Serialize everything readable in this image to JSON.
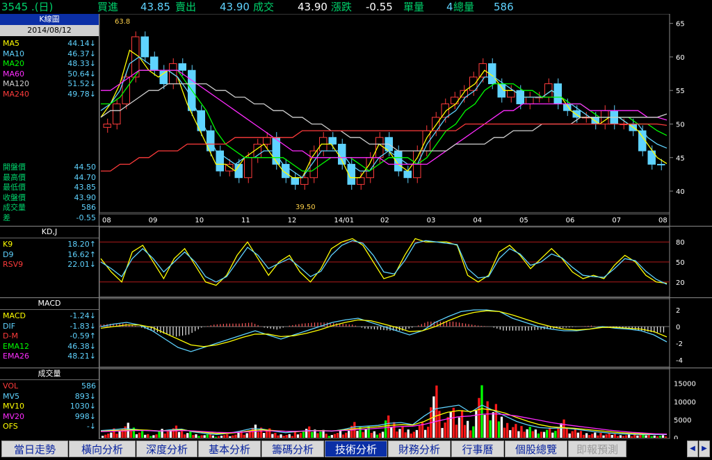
{
  "header": {
    "symbol": "3545 .(日)",
    "bid_label": "買進",
    "bid": "43.85",
    "ask_label": "賣出",
    "ask": "43.90",
    "trade_label": "成交",
    "trade": "43.90",
    "change_label": "漲跌",
    "change": "-0.55",
    "vol_label": "單量",
    "vol": "4",
    "total_label": "總量",
    "total": "586"
  },
  "kline_panel": {
    "title": "K線圖",
    "date": "2014/08/12",
    "ma": [
      {
        "label": "MA5",
        "value": "44.14↓",
        "color": "#ffff00"
      },
      {
        "label": "MA10",
        "value": "46.37↓",
        "color": "#5fd3ff"
      },
      {
        "label": "MA20",
        "value": "48.33↓",
        "color": "#00ff00"
      },
      {
        "label": "MA60",
        "value": "50.64↓",
        "color": "#ff2bff"
      },
      {
        "label": "MA120",
        "value": "51.52↓",
        "color": "#cfcfcf"
      },
      {
        "label": "MA240",
        "value": "49.78↓",
        "color": "#ff3b3b"
      }
    ],
    "quotes": [
      {
        "label": "開盤價",
        "value": "44.50"
      },
      {
        "label": "最高價",
        "value": "44.70"
      },
      {
        "label": "最低價",
        "value": "43.85"
      },
      {
        "label": "收盤價",
        "value": "43.90"
      },
      {
        "label": "成交量",
        "value": "586"
      },
      {
        "label": "差",
        "value": "-0.55"
      }
    ],
    "high_mark": "63.8",
    "low_mark": "39.50"
  },
  "kd_panel": {
    "title": "KD,J",
    "items": [
      {
        "label": "K9",
        "value": "18.20↑",
        "color": "#ffff00"
      },
      {
        "label": "D9",
        "value": "16.62↑",
        "color": "#5fd3ff"
      },
      {
        "label": "RSV9",
        "value": "22.01↓",
        "color": "#ff3b3b"
      }
    ]
  },
  "macd_panel": {
    "title": "MACD",
    "items": [
      {
        "label": "MACD",
        "value": "-1.24↓",
        "color": "#ffff00"
      },
      {
        "label": "DIF",
        "value": "-1.83↓",
        "color": "#5fd3ff"
      },
      {
        "label": "D-M",
        "value": "-0.59↑",
        "color": "#ff3b3b"
      },
      {
        "label": "EMA12",
        "value": "46.38↓",
        "color": "#00ff00"
      },
      {
        "label": "EMA26",
        "value": "48.21↓",
        "color": "#ff2bff"
      }
    ]
  },
  "vol_panel": {
    "title": "成交量",
    "items": [
      {
        "label": "VOL",
        "value": "586",
        "color": "#ff3b3b"
      },
      {
        "label": "MV5",
        "value": "893↓",
        "color": "#5fd3ff"
      },
      {
        "label": "MV10",
        "value": "1030↓",
        "color": "#ffff00"
      },
      {
        "label": "MV20",
        "value": "998↓",
        "color": "#ff2bff"
      },
      {
        "label": "OFS",
        "value": "-↓",
        "color": "#ffff00"
      }
    ]
  },
  "axes": {
    "months": [
      "08",
      "09",
      "10",
      "11",
      "12",
      "14/01",
      "02",
      "03",
      "04",
      "05",
      "06",
      "07",
      "08"
    ],
    "price_ticks": [
      "65",
      "60",
      "55",
      "50",
      "45",
      "40"
    ],
    "kd_ticks": [
      "80",
      "50",
      "20"
    ],
    "macd_ticks": [
      "2",
      "0",
      "-2",
      "-4"
    ],
    "vol_ticks": [
      "15000",
      "10000",
      "5000",
      "0"
    ]
  },
  "tabs": [
    {
      "label": "當日走勢",
      "state": "normal"
    },
    {
      "label": "橫向分析",
      "state": "normal"
    },
    {
      "label": "深度分析",
      "state": "normal"
    },
    {
      "label": "基本分析",
      "state": "normal"
    },
    {
      "label": "籌碼分析",
      "state": "normal"
    },
    {
      "label": "技術分析",
      "state": "active"
    },
    {
      "label": "財務分析",
      "state": "normal"
    },
    {
      "label": "行事曆",
      "state": "normal"
    },
    {
      "label": "個股總覽",
      "state": "normal"
    },
    {
      "label": "即報預測",
      "state": "faded"
    }
  ],
  "chart_data": [
    {
      "type": "candlestick",
      "title": "K線圖",
      "x_months": [
        "08",
        "09",
        "10",
        "11",
        "12",
        "14/01",
        "02",
        "03",
        "04",
        "05",
        "06",
        "07",
        "08"
      ],
      "ylim": [
        37,
        66
      ],
      "close_path": [
        50,
        53,
        57,
        63,
        60,
        58,
        56,
        59,
        58,
        52,
        49,
        46,
        43,
        44,
        42,
        45,
        47,
        48,
        44,
        42,
        41,
        42,
        46,
        48,
        47,
        44,
        41,
        42,
        45,
        48,
        46,
        43,
        42,
        46,
        49,
        51,
        53,
        54,
        55,
        57,
        59,
        56,
        54,
        55,
        53,
        54,
        54,
        56,
        53,
        52,
        51,
        51,
        50,
        52,
        50,
        50,
        49,
        46,
        44,
        43.9
      ],
      "annotations": [
        {
          "label": "63.8",
          "x": "08",
          "y": 63.8
        },
        {
          "label": "39.50",
          "x": "12",
          "y": 39.5
        }
      ],
      "series": [
        {
          "name": "MA5",
          "color": "#ffff00",
          "values": [
            51,
            53,
            56,
            61,
            60,
            58,
            57,
            58,
            57,
            53,
            50,
            47,
            44,
            44,
            43,
            45,
            46,
            47,
            45,
            43,
            42,
            42,
            45,
            47,
            47,
            45,
            42,
            42,
            44,
            47,
            46,
            44,
            43,
            45,
            48,
            50,
            52,
            53,
            55,
            56,
            58,
            57,
            55,
            55,
            54,
            54,
            54,
            55,
            54,
            52,
            51,
            51,
            50,
            51,
            51,
            50,
            49,
            47,
            45,
            44.1
          ]
        },
        {
          "name": "MA10",
          "color": "#5fd3ff",
          "values": [
            52,
            53,
            55,
            59,
            60,
            59,
            58,
            58,
            57,
            55,
            52,
            49,
            46,
            45,
            44,
            45,
            45,
            46,
            46,
            44,
            43,
            42,
            44,
            46,
            46,
            46,
            44,
            43,
            43,
            45,
            46,
            45,
            44,
            44,
            47,
            49,
            51,
            52,
            54,
            55,
            57,
            57,
            56,
            55,
            54,
            54,
            54,
            55,
            54,
            53,
            52,
            51,
            51,
            51,
            51,
            50,
            50,
            48,
            47,
            46.4
          ]
        },
        {
          "name": "MA20",
          "color": "#00ff00",
          "values": [
            53,
            53,
            54,
            56,
            58,
            58,
            58,
            58,
            58,
            56,
            54,
            52,
            49,
            47,
            46,
            45,
            45,
            45,
            45,
            45,
            44,
            43,
            43,
            44,
            45,
            45,
            45,
            44,
            43,
            44,
            45,
            45,
            45,
            44,
            45,
            47,
            49,
            50,
            52,
            53,
            55,
            56,
            56,
            56,
            55,
            55,
            54,
            54,
            54,
            53,
            53,
            52,
            51,
            51,
            51,
            51,
            50,
            50,
            49,
            48.3
          ]
        },
        {
          "name": "MA60",
          "color": "#ff2bff",
          "values": [
            55,
            55,
            56,
            57,
            58,
            58,
            58,
            58,
            58,
            57,
            56,
            55,
            54,
            53,
            52,
            51,
            50,
            49,
            48,
            47,
            46,
            46,
            45,
            45,
            45,
            45,
            45,
            45,
            45,
            45,
            44,
            44,
            44,
            44,
            44,
            45,
            46,
            47,
            48,
            49,
            50,
            51,
            52,
            52,
            53,
            53,
            53,
            53,
            53,
            53,
            53,
            52,
            52,
            52,
            52,
            52,
            52,
            51,
            51,
            50.6
          ]
        },
        {
          "name": "MA120",
          "color": "#cfcfcf",
          "values": [
            51,
            52,
            52,
            53,
            54,
            55,
            55,
            56,
            56,
            56,
            56,
            56,
            55,
            55,
            54,
            54,
            53,
            53,
            52,
            52,
            51,
            51,
            50,
            50,
            49,
            49,
            48,
            48,
            47,
            47,
            47,
            46,
            46,
            46,
            46,
            46,
            46,
            47,
            47,
            47,
            47,
            48,
            48,
            49,
            49,
            49,
            50,
            50,
            50,
            50,
            51,
            51,
            51,
            51,
            51,
            51,
            51,
            51,
            51,
            51.5
          ]
        },
        {
          "name": "MA240",
          "color": "#ff3b3b",
          "values": [
            43,
            43,
            44,
            44,
            45,
            45,
            46,
            46,
            46,
            47,
            47,
            47,
            47,
            47,
            48,
            48,
            48,
            48,
            48,
            48,
            48,
            49,
            49,
            49,
            49,
            49,
            49,
            49,
            49,
            49,
            49,
            49,
            49,
            49,
            49,
            49,
            49,
            49,
            50,
            50,
            50,
            50,
            50,
            50,
            50,
            50,
            50,
            50,
            50,
            50,
            50,
            50,
            50,
            50,
            50,
            50,
            50,
            50,
            50,
            49.8
          ]
        }
      ]
    },
    {
      "type": "line",
      "title": "KD,J",
      "ylim": [
        0,
        100
      ],
      "series": [
        {
          "name": "K9",
          "color": "#ffff00",
          "values": [
            55,
            35,
            20,
            65,
            75,
            50,
            25,
            55,
            70,
            45,
            20,
            15,
            30,
            60,
            80,
            55,
            30,
            50,
            60,
            35,
            20,
            40,
            70,
            80,
            85,
            75,
            50,
            25,
            30,
            60,
            85,
            80,
            80,
            80,
            75,
            30,
            20,
            30,
            65,
            75,
            60,
            40,
            55,
            70,
            55,
            35,
            25,
            30,
            25,
            45,
            60,
            50,
            30,
            20,
            18
          ]
        },
        {
          "name": "D9",
          "color": "#5fd3ff",
          "values": [
            50,
            40,
            28,
            55,
            70,
            55,
            35,
            50,
            65,
            50,
            28,
            20,
            28,
            50,
            72,
            60,
            40,
            48,
            55,
            42,
            28,
            36,
            60,
            75,
            82,
            78,
            60,
            35,
            32,
            52,
            78,
            82,
            80,
            78,
            76,
            40,
            26,
            28,
            55,
            70,
            62,
            45,
            50,
            62,
            56,
            42,
            30,
            28,
            27,
            40,
            55,
            52,
            36,
            24,
            16.6
          ]
        }
      ]
    },
    {
      "type": "bar",
      "title": "MACD",
      "ylim": [
        -4.5,
        3
      ],
      "series": [
        {
          "name": "DIF",
          "color": "#5fd3ff",
          "values": [
            0,
            0.3,
            0.5,
            0.2,
            -0.5,
            -1.5,
            -2.5,
            -3,
            -2.5,
            -2,
            -1.5,
            -1,
            -0.5,
            -1,
            -1.5,
            -1,
            -0.5,
            0,
            0.5,
            0.8,
            1,
            0.5,
            0,
            -0.5,
            -1,
            -0.5,
            0.5,
            1.2,
            1.8,
            2,
            2,
            1.8,
            1,
            0.5,
            0,
            -0.3,
            -0.5,
            -0.5,
            -0.3,
            0,
            -0.2,
            -0.3,
            -0.5,
            -1,
            -1.83
          ]
        },
        {
          "name": "MACD",
          "color": "#ffff00",
          "values": [
            -0.2,
            0,
            0.2,
            0.2,
            -0.1,
            -0.8,
            -1.5,
            -2.2,
            -2.4,
            -2.2,
            -1.8,
            -1.3,
            -0.9,
            -0.9,
            -1.2,
            -1.1,
            -0.8,
            -0.4,
            0.1,
            0.5,
            0.8,
            0.7,
            0.3,
            -0.1,
            -0.6,
            -0.5,
            0,
            0.7,
            1.3,
            1.7,
            1.9,
            1.8,
            1.4,
            0.9,
            0.4,
            0,
            -0.3,
            -0.4,
            -0.3,
            -0.1,
            -0.1,
            -0.2,
            -0.3,
            -0.6,
            -1.24
          ]
        }
      ]
    },
    {
      "type": "bar",
      "title": "成交量",
      "ylim": [
        0,
        18000
      ],
      "values": [
        1200,
        2500,
        4000,
        1800,
        900,
        2200,
        3000,
        1500,
        800,
        1000,
        600,
        900,
        1800,
        3500,
        2500,
        1200,
        900,
        1500,
        2600,
        1800,
        1100,
        2000,
        4200,
        3000,
        1600,
        5500,
        2800,
        1900,
        3500,
        12000,
        6000,
        8000,
        4500,
        14000,
        9000,
        5200,
        3400,
        2700,
        1900,
        2300,
        4200,
        2600,
        1800,
        1400,
        1200,
        900,
        800,
        1000,
        700,
        586
      ],
      "series": [
        {
          "name": "MV5",
          "color": "#5fd3ff",
          "values": [
            2000,
            2200,
            2500,
            2300,
            2000,
            1800,
            2200,
            2400,
            1600,
            1200,
            900,
            1200,
            1800,
            2500,
            2400,
            1800,
            1400,
            1700,
            2000,
            2000,
            1800,
            2300,
            3000,
            3200,
            3400,
            4000,
            4200,
            3600,
            6000,
            8000,
            8500,
            9000,
            7000,
            9000,
            7500,
            6000,
            4500,
            3500,
            2800,
            2600,
            2700,
            2400,
            2000,
            1600,
            1300,
            1100,
            950,
            900,
            890,
            893
          ]
        },
        {
          "name": "MV10",
          "color": "#ffff00",
          "values": [
            1800,
            2000,
            2100,
            2200,
            2100,
            1900,
            2000,
            2200,
            1800,
            1500,
            1200,
            1200,
            1500,
            2000,
            2200,
            2000,
            1800,
            1700,
            1900,
            2000,
            1900,
            2100,
            2500,
            2800,
            3000,
            3400,
            3600,
            3500,
            4500,
            6000,
            7000,
            7500,
            7200,
            8000,
            7600,
            6800,
            5600,
            4500,
            3600,
            3000,
            2800,
            2600,
            2300,
            2000,
            1700,
            1400,
            1200,
            1100,
            1050,
            1030
          ]
        },
        {
          "name": "MV20",
          "color": "#ff2bff",
          "values": [
            1700,
            1800,
            1900,
            2000,
            2000,
            1900,
            1900,
            2000,
            1900,
            1700,
            1500,
            1400,
            1500,
            1700,
            1900,
            1900,
            1800,
            1800,
            1900,
            1900,
            1900,
            2000,
            2200,
            2400,
            2600,
            2900,
            3100,
            3200,
            3700,
            4500,
            5200,
            5800,
            6000,
            6500,
            6600,
            6400,
            6000,
            5400,
            4800,
            4200,
            3700,
            3300,
            2900,
            2500,
            2100,
            1800,
            1500,
            1300,
            1100,
            998
          ]
        }
      ]
    }
  ]
}
